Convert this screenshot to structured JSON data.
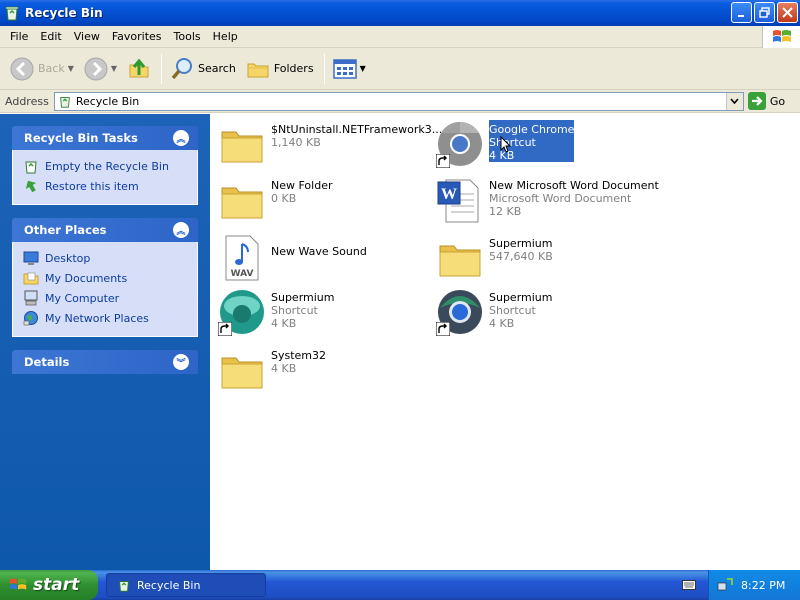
{
  "window": {
    "title": "Recycle Bin"
  },
  "menubar": {
    "items": [
      "File",
      "Edit",
      "View",
      "Favorites",
      "Tools",
      "Help"
    ]
  },
  "toolbar": {
    "back_label": "Back",
    "search_label": "Search",
    "folders_label": "Folders"
  },
  "address": {
    "label": "Address",
    "value": "Recycle Bin",
    "go_label": "Go"
  },
  "tasks_panel": {
    "title": "Recycle Bin Tasks",
    "links": [
      "Empty the Recycle Bin",
      "Restore this item"
    ]
  },
  "places_panel": {
    "title": "Other Places",
    "links": [
      "Desktop",
      "My Documents",
      "My Computer",
      "My Network Places"
    ]
  },
  "details_panel": {
    "title": "Details"
  },
  "files": [
    {
      "name": "$NtUninstall.NETFramework3....",
      "sub": "",
      "size": "1,140 KB",
      "icon": "folder-icon"
    },
    {
      "name": "Google Chrome",
      "sub": "Shortcut",
      "size": "4 KB",
      "icon": "chrome-icon",
      "selected": true
    },
    {
      "name": "New Folder",
      "sub": "",
      "size": "0 KB",
      "icon": "folder-icon"
    },
    {
      "name": "New Microsoft Word Document",
      "sub": "Microsoft Word Document",
      "size": "12 KB",
      "icon": "word-document-icon"
    },
    {
      "name": "New Wave Sound",
      "sub": "",
      "size": "",
      "icon": "wav-file-icon"
    },
    {
      "name": "Supermium",
      "sub": "",
      "size": "547,640 KB",
      "icon": "folder-icon"
    },
    {
      "name": "Supermium",
      "sub": "Shortcut",
      "size": "4 KB",
      "icon": "supermium-teal-icon"
    },
    {
      "name": "Supermium",
      "sub": "Shortcut",
      "size": "4 KB",
      "icon": "supermium-blue-icon"
    },
    {
      "name": "System32",
      "sub": "",
      "size": "4 KB",
      "icon": "folder-icon"
    }
  ],
  "taskbar": {
    "start_label": "start",
    "task_label": "Recycle Bin",
    "clock": "8:22 PM"
  }
}
